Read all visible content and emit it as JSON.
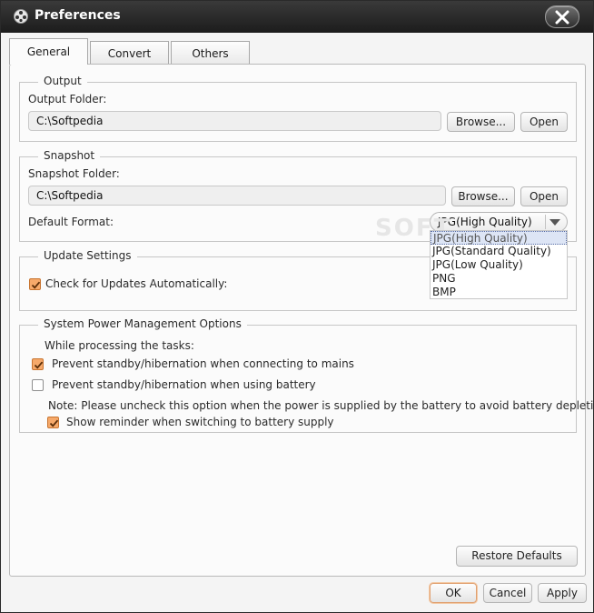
{
  "window": {
    "title": "Preferences"
  },
  "tabs": [
    {
      "label": "General",
      "active": true
    },
    {
      "label": "Convert",
      "active": false
    },
    {
      "label": "Others",
      "active": false
    }
  ],
  "output": {
    "legend": "Output",
    "folder_label": "Output Folder:",
    "folder_value": "C:\\Softpedia",
    "browse_label": "Browse...",
    "open_label": "Open"
  },
  "snapshot": {
    "legend": "Snapshot",
    "folder_label": "Snapshot Folder:",
    "folder_value": "C:\\Softpedia",
    "browse_label": "Browse...",
    "open_label": "Open",
    "format_label": "Default Format:",
    "format_value": "JPG(High Quality)",
    "format_options": [
      "JPG(High Quality)",
      "JPG(Standard Quality)",
      "JPG(Low Quality)",
      "PNG",
      "BMP"
    ]
  },
  "update": {
    "legend": "Update Settings",
    "auto_check_label": "Check for Updates Automatically:",
    "auto_check": true
  },
  "power": {
    "legend": "System Power Management Options",
    "intro": "While processing the tasks:",
    "prevent_mains_label": "Prevent standby/hibernation when connecting to mains",
    "prevent_mains": true,
    "prevent_battery_label": "Prevent standby/hibernation when using battery",
    "prevent_battery": false,
    "note": "Note: Please uncheck this option when the power is supplied by the battery to avoid battery depletion.",
    "reminder_label": "Show reminder when switching to battery supply",
    "reminder": true
  },
  "footer": {
    "restore_label": "Restore Defaults",
    "ok_label": "OK",
    "cancel_label": "Cancel",
    "apply_label": "Apply"
  },
  "watermark": "SOFT",
  "colors": {
    "titlebar": "#1c1c1c",
    "checkbox_on": "#f6a96a",
    "accent_border": "#e0a070"
  }
}
